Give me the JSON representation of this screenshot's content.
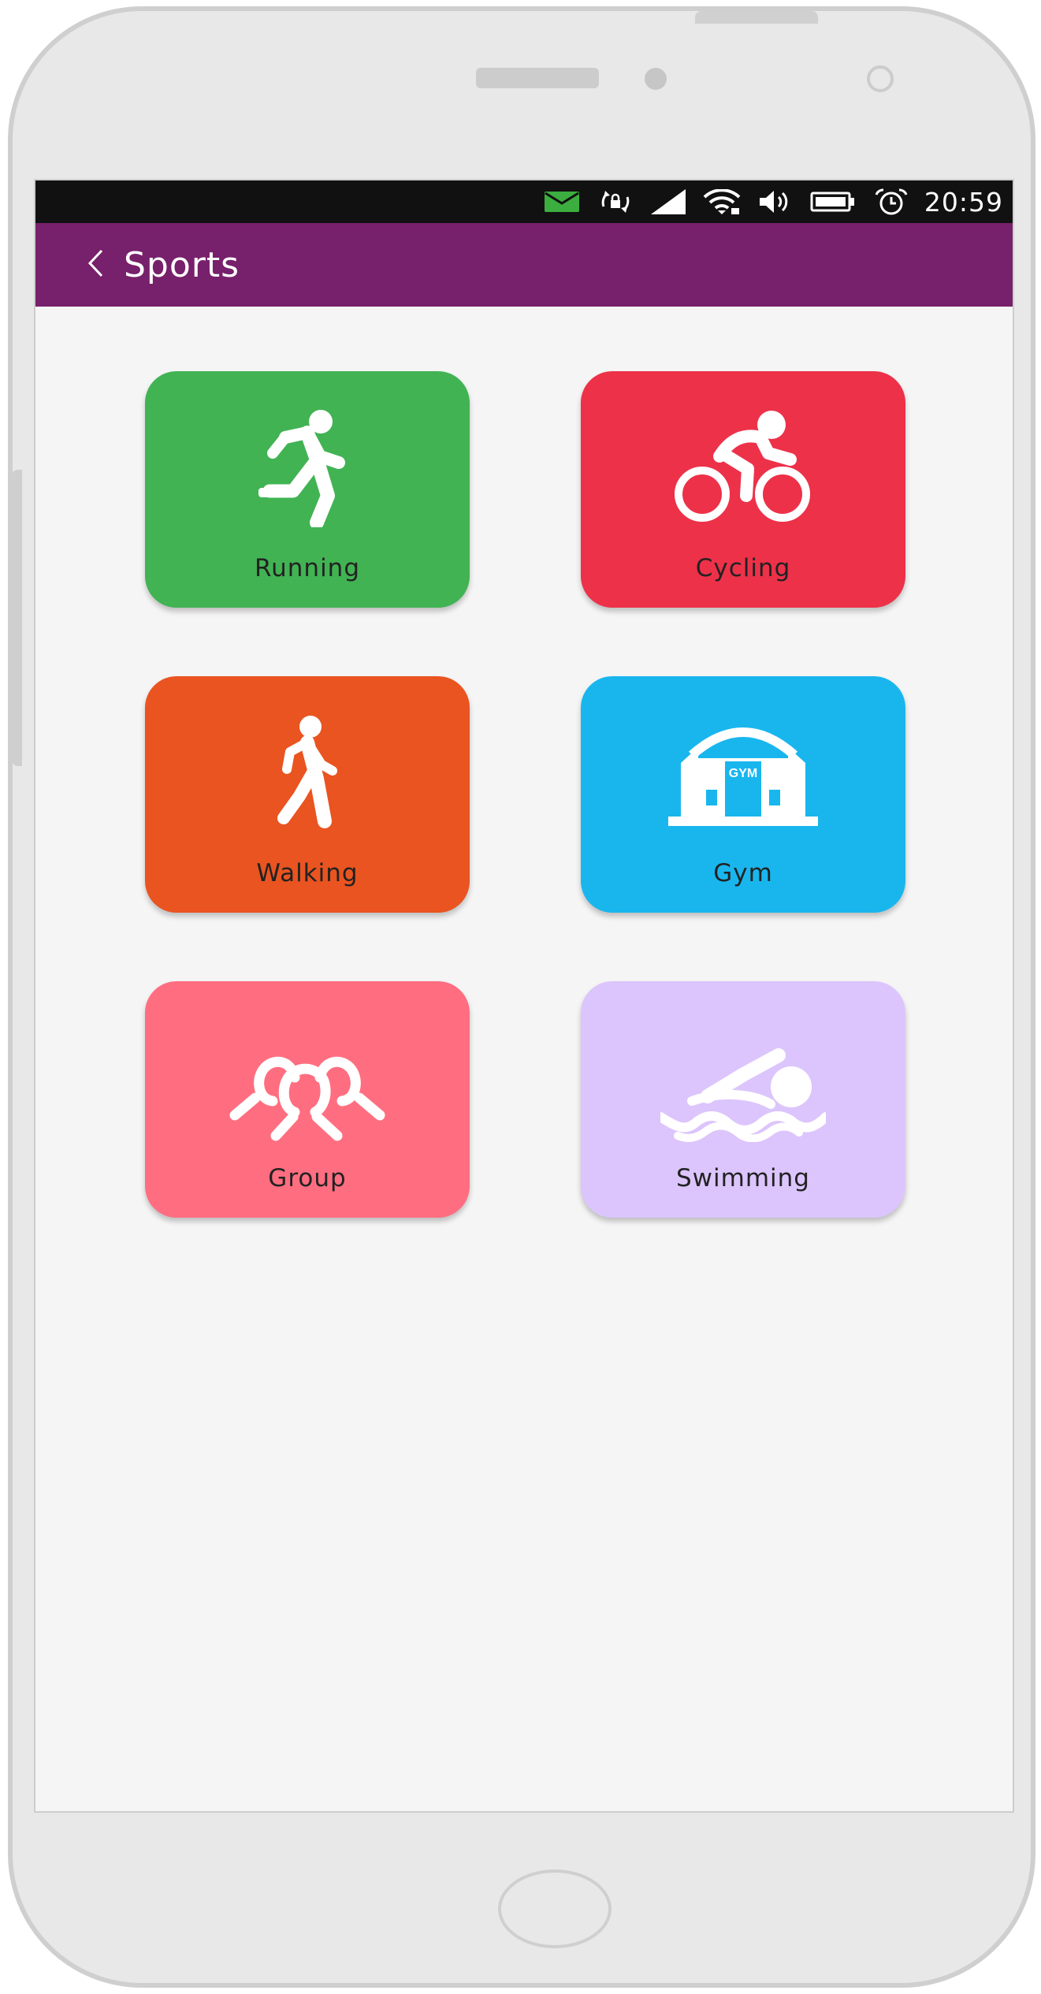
{
  "status_bar": {
    "time": "20:59",
    "icons": [
      "mail-icon",
      "rotation-lock-icon",
      "cellular-signal-icon",
      "wifi-icon",
      "volume-icon",
      "battery-icon",
      "alarm-icon"
    ],
    "mail_color": "#3cae3f"
  },
  "header": {
    "title": "Sports",
    "back_icon": "chevron-left-icon",
    "color": "#77206b"
  },
  "tiles": [
    {
      "label": "Running",
      "icon": "running-icon",
      "color": "#41b353"
    },
    {
      "label": "Cycling",
      "icon": "cycling-icon",
      "color": "#ed3149"
    },
    {
      "label": "Walking",
      "icon": "walking-icon",
      "color": "#e95420"
    },
    {
      "label": "Gym",
      "icon": "gym-icon",
      "icon_text": "GYM",
      "color": "#19b6ee"
    },
    {
      "label": "Group",
      "icon": "group-icon",
      "color": "#ff6e80"
    },
    {
      "label": "Swimming",
      "icon": "swimming-icon",
      "color": "#dcc5fc"
    }
  ]
}
